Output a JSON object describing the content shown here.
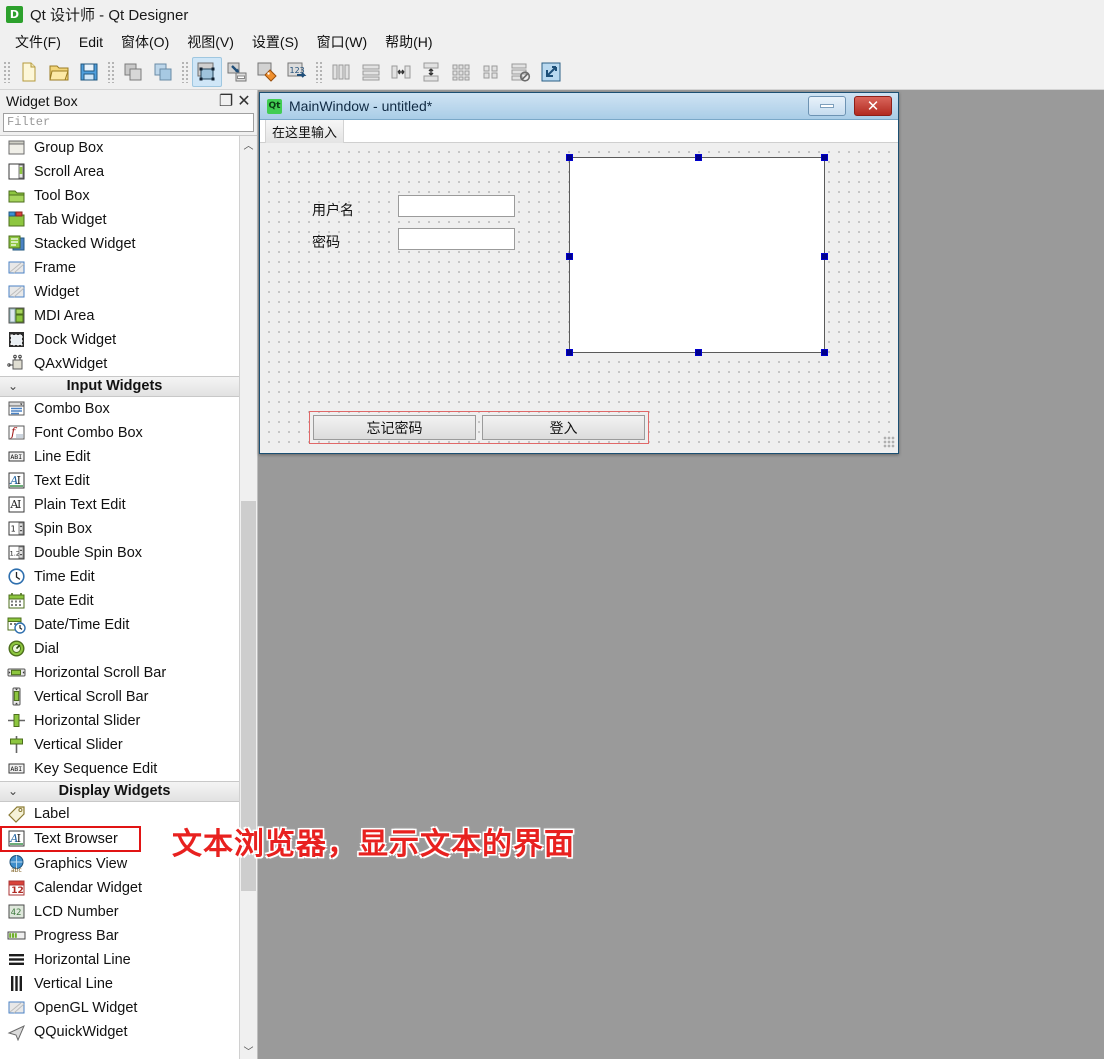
{
  "window": {
    "app_icon": "D",
    "title": "Qt 设计师 - Qt Designer"
  },
  "menubar": {
    "items": [
      {
        "label": "文件(F)",
        "name": "menu-file"
      },
      {
        "label": "Edit",
        "name": "menu-edit"
      },
      {
        "label": "窗体(O)",
        "name": "menu-form"
      },
      {
        "label": "视图(V)",
        "name": "menu-view"
      },
      {
        "label": "设置(S)",
        "name": "menu-settings"
      },
      {
        "label": "窗口(W)",
        "name": "menu-window"
      },
      {
        "label": "帮助(H)",
        "name": "menu-help"
      }
    ]
  },
  "toolbar": {
    "groups": [
      [
        "new-file-icon",
        "open-file-icon",
        "save-file-icon"
      ],
      [
        "undo-icon",
        "redo-icon"
      ],
      [
        "edit-widgets-icon",
        "edit-signals-slots-icon",
        "edit-buddies-icon",
        "edit-tab-order-icon"
      ],
      [
        "layout-horizontally-icon",
        "layout-vertically-icon",
        "layout-splitter-horizontal-icon",
        "layout-splitter-vertical-icon",
        "layout-in-grid-icon",
        "layout-in-form-icon",
        "break-layout-icon",
        "adjust-size-icon"
      ]
    ]
  },
  "widget_box": {
    "title": "Widget Box",
    "undock_label": "❐",
    "close_label": "✕",
    "filter_placeholder": "Filter",
    "filter_value": "",
    "scrollbar": {
      "up": "︿",
      "down": "﹀"
    },
    "sections": [
      {
        "name": "containers",
        "header": null,
        "items": [
          {
            "label": "Group Box",
            "icon": "group-box-icon"
          },
          {
            "label": "Scroll Area",
            "icon": "scroll-area-icon"
          },
          {
            "label": "Tool Box",
            "icon": "tool-box-icon"
          },
          {
            "label": "Tab Widget",
            "icon": "tab-widget-icon"
          },
          {
            "label": "Stacked Widget",
            "icon": "stacked-widget-icon"
          },
          {
            "label": "Frame",
            "icon": "frame-icon"
          },
          {
            "label": "Widget",
            "icon": "widget-icon"
          },
          {
            "label": "MDI Area",
            "icon": "mdi-area-icon"
          },
          {
            "label": "Dock Widget",
            "icon": "dock-widget-icon"
          },
          {
            "label": "QAxWidget",
            "icon": "qax-widget-icon"
          }
        ]
      },
      {
        "name": "input-widgets",
        "header": "Input Widgets",
        "items": [
          {
            "label": "Combo Box",
            "icon": "combo-box-icon"
          },
          {
            "label": "Font Combo Box",
            "icon": "font-combo-box-icon"
          },
          {
            "label": "Line Edit",
            "icon": "line-edit-icon"
          },
          {
            "label": "Text Edit",
            "icon": "text-edit-icon"
          },
          {
            "label": "Plain Text Edit",
            "icon": "plain-text-edit-icon"
          },
          {
            "label": "Spin Box",
            "icon": "spin-box-icon"
          },
          {
            "label": "Double Spin Box",
            "icon": "double-spin-box-icon"
          },
          {
            "label": "Time Edit",
            "icon": "time-edit-icon"
          },
          {
            "label": "Date Edit",
            "icon": "date-edit-icon"
          },
          {
            "label": "Date/Time Edit",
            "icon": "date-time-edit-icon"
          },
          {
            "label": "Dial",
            "icon": "dial-icon"
          },
          {
            "label": "Horizontal Scroll Bar",
            "icon": "horizontal-scroll-bar-icon"
          },
          {
            "label": "Vertical Scroll Bar",
            "icon": "vertical-scroll-bar-icon"
          },
          {
            "label": "Horizontal Slider",
            "icon": "horizontal-slider-icon"
          },
          {
            "label": "Vertical Slider",
            "icon": "vertical-slider-icon"
          },
          {
            "label": "Key Sequence Edit",
            "icon": "key-sequence-edit-icon"
          }
        ]
      },
      {
        "name": "display-widgets",
        "header": "Display Widgets",
        "items": [
          {
            "label": "Label",
            "icon": "label-icon"
          },
          {
            "label": "Text Browser",
            "icon": "text-browser-icon",
            "highlighted": true
          },
          {
            "label": "Graphics View",
            "icon": "graphics-view-icon"
          },
          {
            "label": "Calendar Widget",
            "icon": "calendar-widget-icon"
          },
          {
            "label": "LCD Number",
            "icon": "lcd-number-icon"
          },
          {
            "label": "Progress Bar",
            "icon": "progress-bar-icon"
          },
          {
            "label": "Horizontal Line",
            "icon": "horizontal-line-icon"
          },
          {
            "label": "Vertical Line",
            "icon": "vertical-line-icon"
          },
          {
            "label": "OpenGL Widget",
            "icon": "opengl-widget-icon"
          },
          {
            "label": "QQuickWidget",
            "icon": "qquick-widget-icon"
          }
        ]
      }
    ]
  },
  "form": {
    "icon": "Qt",
    "title": "MainWindow - untitled*",
    "minimize_label": "",
    "close_label": "✕",
    "menubar_placeholder": "在这里输入",
    "labels": [
      {
        "text": "用户名",
        "name": "username-label"
      },
      {
        "text": "密码",
        "name": "password-label"
      }
    ],
    "fields": [
      {
        "value": "",
        "name": "username-input"
      },
      {
        "value": "",
        "name": "password-input"
      }
    ],
    "buttons": [
      {
        "text": "忘记密码",
        "name": "forgot-password-button"
      },
      {
        "text": "登入",
        "name": "login-button"
      }
    ],
    "text_browser": {
      "name": "text-browser-widget",
      "content": "",
      "selected": true
    }
  },
  "annotation": {
    "text": "文本浏览器，显示文本的界面",
    "color": "#e8211f"
  }
}
